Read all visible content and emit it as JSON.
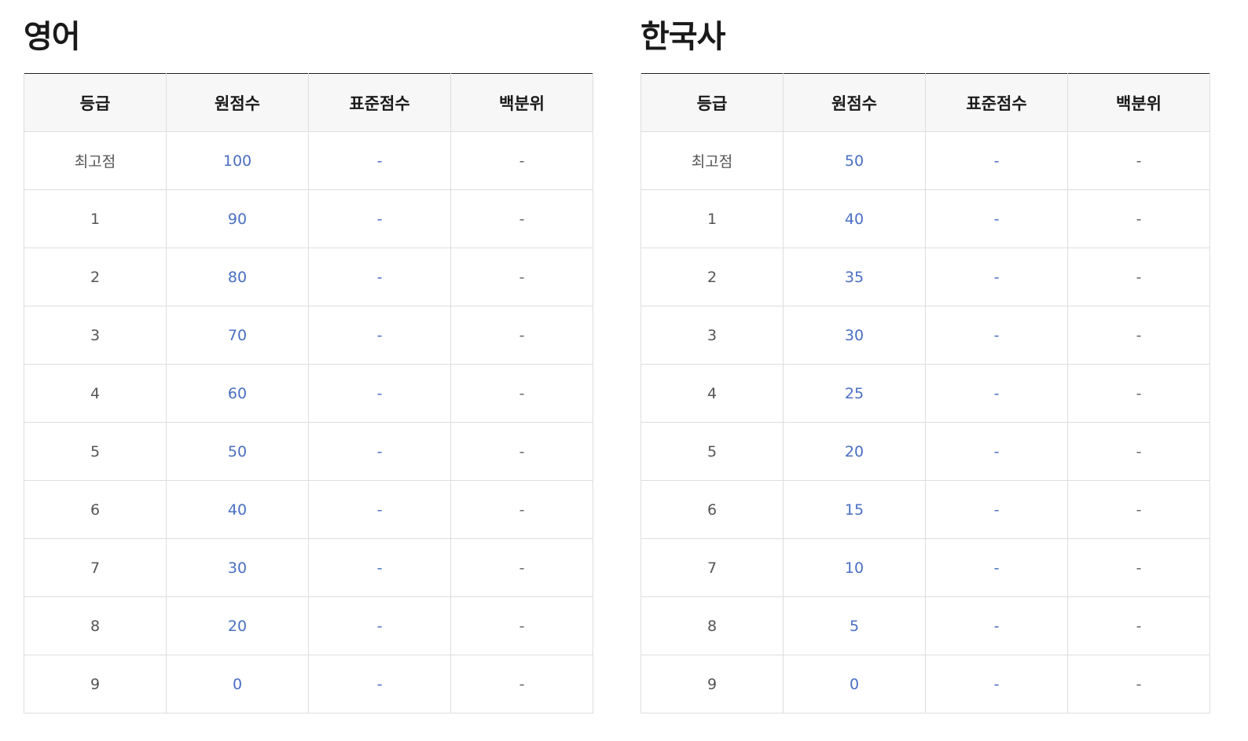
{
  "colors": {
    "raw_score_text": "#4a6fc3",
    "standard_score_text": "#4a6fc3",
    "header_background": "#f7f7f7",
    "table_top_border": "#1f1f1f"
  },
  "tables": [
    {
      "title": "영어",
      "headers": [
        "등급",
        "원점수",
        "표준점수",
        "백분위"
      ],
      "rows": [
        {
          "grade": "최고점",
          "raw": "100",
          "standard": "-",
          "percentile": "-"
        },
        {
          "grade": "1",
          "raw": "90",
          "standard": "-",
          "percentile": "-"
        },
        {
          "grade": "2",
          "raw": "80",
          "standard": "-",
          "percentile": "-"
        },
        {
          "grade": "3",
          "raw": "70",
          "standard": "-",
          "percentile": "-"
        },
        {
          "grade": "4",
          "raw": "60",
          "standard": "-",
          "percentile": "-"
        },
        {
          "grade": "5",
          "raw": "50",
          "standard": "-",
          "percentile": "-"
        },
        {
          "grade": "6",
          "raw": "40",
          "standard": "-",
          "percentile": "-"
        },
        {
          "grade": "7",
          "raw": "30",
          "standard": "-",
          "percentile": "-"
        },
        {
          "grade": "8",
          "raw": "20",
          "standard": "-",
          "percentile": "-"
        },
        {
          "grade": "9",
          "raw": "0",
          "standard": "-",
          "percentile": "-"
        }
      ]
    },
    {
      "title": "한국사",
      "headers": [
        "등급",
        "원점수",
        "표준점수",
        "백분위"
      ],
      "rows": [
        {
          "grade": "최고점",
          "raw": "50",
          "standard": "-",
          "percentile": "-"
        },
        {
          "grade": "1",
          "raw": "40",
          "standard": "-",
          "percentile": "-"
        },
        {
          "grade": "2",
          "raw": "35",
          "standard": "-",
          "percentile": "-"
        },
        {
          "grade": "3",
          "raw": "30",
          "standard": "-",
          "percentile": "-"
        },
        {
          "grade": "4",
          "raw": "25",
          "standard": "-",
          "percentile": "-"
        },
        {
          "grade": "5",
          "raw": "20",
          "standard": "-",
          "percentile": "-"
        },
        {
          "grade": "6",
          "raw": "15",
          "standard": "-",
          "percentile": "-"
        },
        {
          "grade": "7",
          "raw": "10",
          "standard": "-",
          "percentile": "-"
        },
        {
          "grade": "8",
          "raw": "5",
          "standard": "-",
          "percentile": "-"
        },
        {
          "grade": "9",
          "raw": "0",
          "standard": "-",
          "percentile": "-"
        }
      ]
    }
  ]
}
